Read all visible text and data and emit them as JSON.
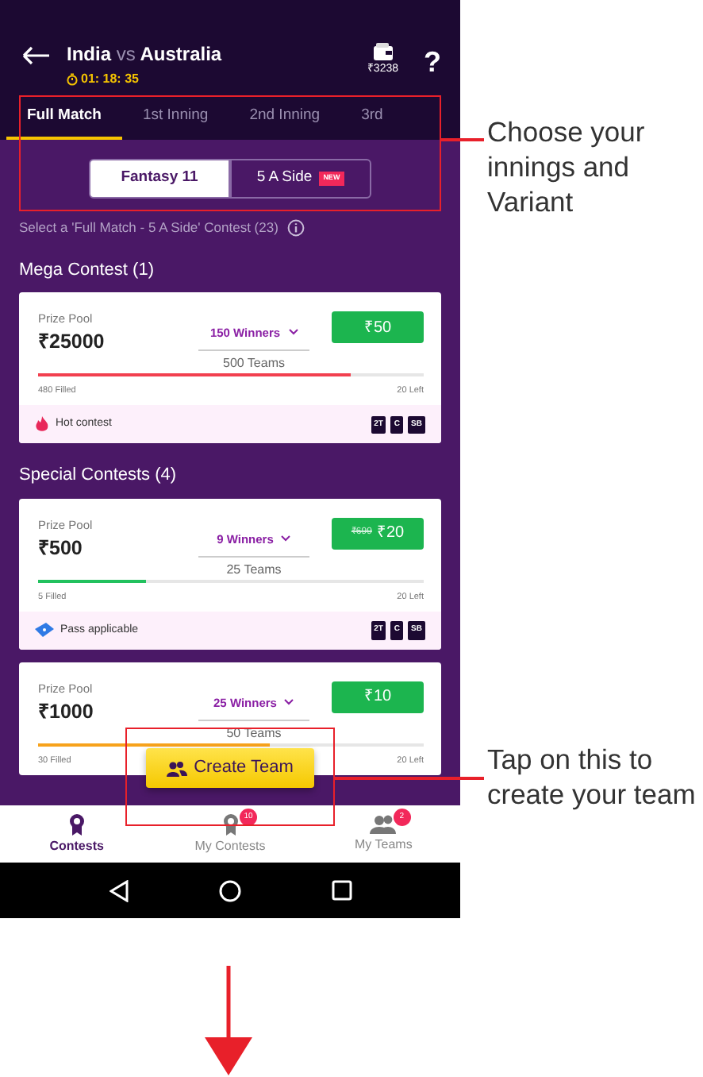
{
  "match": {
    "team_1": "India",
    "vs": "vs",
    "team_2": "Australia",
    "timer": "01: 18: 35"
  },
  "wallet": {
    "balance": "₹3238"
  },
  "help": "?",
  "innings_tabs": [
    {
      "label": "Full Match",
      "selected": true
    },
    {
      "label": "1st Inning",
      "selected": false
    },
    {
      "label": "2nd Inning",
      "selected": false
    },
    {
      "label": "3rd",
      "selected": false
    }
  ],
  "variants": [
    {
      "label": "Fantasy 11",
      "selected": true
    },
    {
      "label": "5 A Side",
      "selected": false,
      "badge": "NEW"
    }
  ],
  "info_text": "Select a 'Full Match - 5 A Side' Contest (23)",
  "sections": [
    {
      "title": "Mega Contest (1)",
      "contests": [
        {
          "prize_label": "Prize Pool",
          "prize": "₹25000",
          "winners": "150 Winners",
          "teams": "500 Teams",
          "entry_fee": "₹50",
          "level": 0.81,
          "color": "#f2404f",
          "filled": "480 Filled",
          "left": "20 Left",
          "kind": "hot",
          "tag": "Hot contest",
          "badges": [
            "2T",
            "C",
            "SB"
          ]
        }
      ]
    },
    {
      "title": "Special Contests (4)",
      "contests": [
        {
          "prize_label": "Prize Pool",
          "prize": "₹500",
          "winners": "9 Winners",
          "teams": "25 Teams",
          "old_fee": "₹699",
          "entry_fee": "₹20",
          "level": 0.28,
          "color": "#22c15e",
          "filled": "5 Filled",
          "left": "20 Left",
          "kind": "pass",
          "tag": "Pass applicable",
          "badges": [
            "2T",
            "C",
            "SB"
          ]
        },
        {
          "prize_label": "Prize Pool",
          "prize": "₹1000",
          "winners": "25 Winners",
          "teams": "50 Teams",
          "entry_fee": "₹10",
          "level": 0.6,
          "color": "#f7a21c",
          "filled": "30 Filled",
          "left": "20 Left"
        }
      ]
    }
  ],
  "create_team_button": "Create Team",
  "bottom_nav": [
    {
      "label": "Contests",
      "selected": true
    },
    {
      "label": "My Contests",
      "selected": false,
      "badge": "10"
    },
    {
      "label": "My Teams",
      "selected": false,
      "badge": "2"
    }
  ],
  "callouts": [
    {
      "text": "Choose your innings and Variant"
    },
    {
      "text": "Tap on this to create your team"
    }
  ]
}
